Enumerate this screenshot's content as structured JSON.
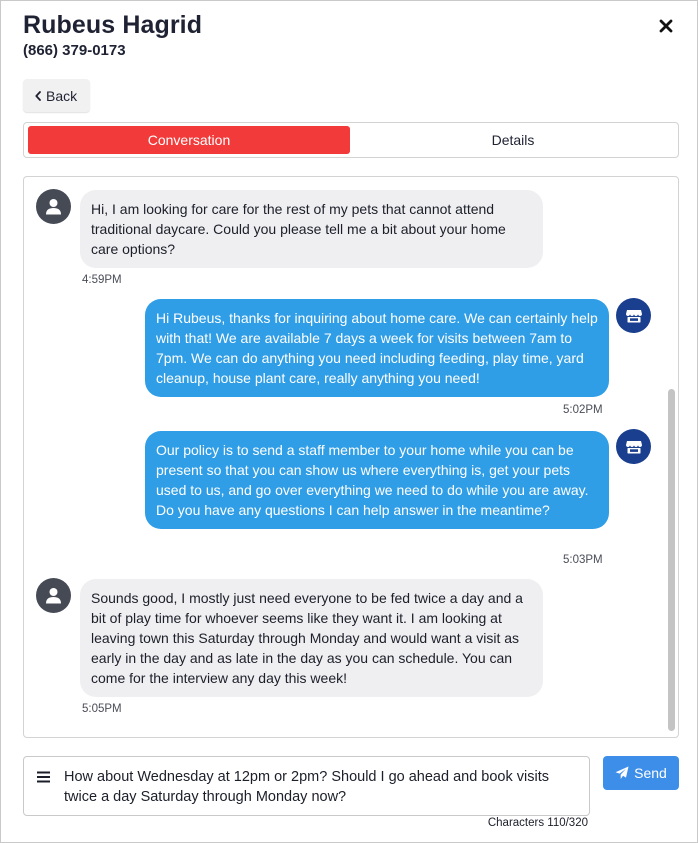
{
  "contact": {
    "name": "Rubeus Hagrid",
    "phone": "(866) 379-0173"
  },
  "header": {
    "close_icon": "close-icon",
    "back_label": "Back",
    "back_icon": "chevron-left-icon"
  },
  "tabs": [
    {
      "label": "Conversation",
      "active": true
    },
    {
      "label": "Details",
      "active": false
    }
  ],
  "messages": [
    {
      "direction": "incoming",
      "avatar_icon": "user-icon",
      "text": "Hi, I am looking for care for the rest of my pets that cannot attend traditional daycare. Could you please tell me a bit about your home care options?",
      "time": "4:59PM"
    },
    {
      "direction": "outgoing",
      "avatar_icon": "storefront-icon",
      "text": "Hi Rubeus, thanks for inquiring about home care. We can certainly help with that! We are available 7 days a week for visits between 7am to 7pm. We can do anything you need including feeding, play time, yard cleanup, house plant care, really anything you need!",
      "time": "5:02PM"
    },
    {
      "direction": "outgoing",
      "avatar_icon": "storefront-icon",
      "text": "Our policy is to send a staff member to your home while you can be present so that you can show us where everything is, get your pets used to us, and go over everything we need to do while you are away. Do you have any questions I can help answer in the meantime?",
      "time": "5:03PM"
    },
    {
      "direction": "incoming",
      "avatar_icon": "user-icon",
      "text": "Sounds good, I mostly just need everyone to be fed twice a day and a bit of play time for whoever seems like they want it. I am looking at leaving town this Saturday through Monday and would want a visit as early in the day and as late in the day as you can schedule. You can come for the interview any day this week!",
      "time": "5:05PM"
    }
  ],
  "compose": {
    "menu_icon": "menu-icon",
    "value": "How about Wednesday at 12pm or 2pm? Should I go ahead and book visits twice a day Saturday through Monday now?",
    "send_label": "Send",
    "send_icon": "paper-plane-icon",
    "char_count": "Characters 110/320"
  },
  "colors": {
    "active_tab": "#f23a3a",
    "outgoing_bubble": "#2f9ee6",
    "incoming_bubble": "#efeff1",
    "send_button": "#3d8ee8",
    "business_avatar": "#1b3f8f",
    "user_avatar": "#454a55"
  }
}
